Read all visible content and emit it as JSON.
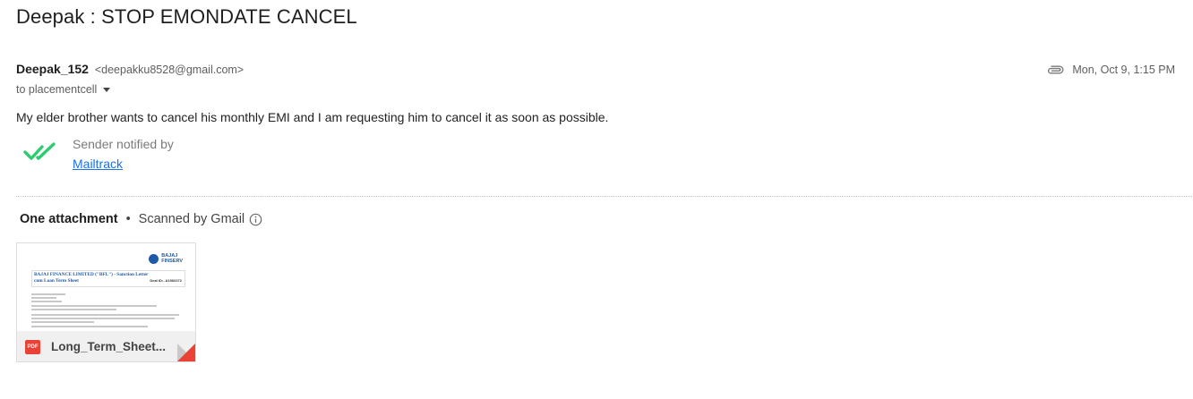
{
  "email": {
    "subject": "Deepak : STOP EMONDATE CANCEL",
    "sender_name": "Deepak_152",
    "sender_email": "<deepakku8528@gmail.com>",
    "to": "to placementcell",
    "date": "Mon, Oct 9, 1:15 PM",
    "body": "My elder brother wants to cancel his monthly EMI and I am requesting him to cancel it as soon as possible."
  },
  "mailtrack": {
    "notified_text": "Sender notified by",
    "link_text": "Mailtrack",
    "check_color": "#2ecc71"
  },
  "attachments": {
    "count_label": "One attachment",
    "separator": "•",
    "scanned_label": "Scanned by Gmail",
    "items": [
      {
        "file_name": "Long_Term_Sheet...",
        "type_badge": "PDF",
        "thumbnail": {
          "logo_line1": "BAJAJ",
          "logo_line2": "FINSERV",
          "title": "BAJAJ FINANCE LIMITED (\"BFL\") - Sanction Letter cum Loan Term Sheet",
          "ref": "Deal ID:- A1960272"
        }
      }
    ]
  },
  "colors": {
    "link": "#1a73e8",
    "pdf_red": "#ea4335",
    "brand_blue": "#1e5aa8"
  },
  "icons": {
    "attachment": "paperclip-icon",
    "checks": "double-check-icon",
    "info": "info-icon",
    "pdf": "pdf-icon"
  }
}
